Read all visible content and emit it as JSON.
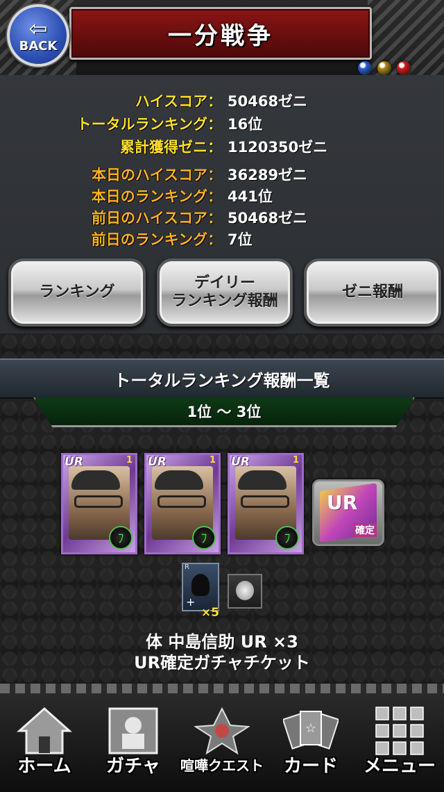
{
  "header": {
    "title": "一分戦争",
    "back_label": "BACK",
    "back_arrow": "⇦",
    "gem_colors": [
      "#2c5fd4",
      "#b08a16",
      "#d41c1c"
    ]
  },
  "stats": [
    {
      "key": "ハイスコア：",
      "value": "50468ゼニ",
      "color": "yellow"
    },
    {
      "key": "トータルランキング：",
      "value": "16位",
      "color": "yellow"
    },
    {
      "key": "累計獲得ゼニ：",
      "value": "1120350ゼニ",
      "color": "yellow"
    },
    {
      "key": "本日のハイスコア：",
      "value": "36289ゼニ",
      "color": "orange"
    },
    {
      "key": "本日のランキング：",
      "value": "441位",
      "color": "orange"
    },
    {
      "key": "前日のハイスコア：",
      "value": "50468ゼニ",
      "color": "orange"
    },
    {
      "key": "前日のランキング：",
      "value": "7位",
      "color": "orange"
    }
  ],
  "buttons": {
    "ranking": "ランキング",
    "daily_line1": "デイリー",
    "daily_line2": "ランキング報酬",
    "zeni": "ゼニ報酬"
  },
  "rewards": {
    "section_title": "トータルランキング報酬一覧",
    "rank_range": "1位 〜 3位",
    "card_rarity": "UR",
    "card_level": "1",
    "attr_glyph": "ﾌ",
    "ticket_label": "UR",
    "ticket_sub": "確定",
    "item_rarity": "R",
    "item_plus": "+",
    "item_qty": "×5",
    "line1": "体 中島信助 UR ×3",
    "line2": "UR確定ガチャチケット"
  },
  "nav": [
    {
      "label": "ホーム",
      "icon": "home-icon"
    },
    {
      "label": "ガチャ",
      "icon": "gacha-icon"
    },
    {
      "label": "喧嘩クエスト",
      "icon": "quest-icon"
    },
    {
      "label": "カード",
      "icon": "cards-icon"
    },
    {
      "label": "メニュー",
      "icon": "menu-grid-icon"
    }
  ]
}
